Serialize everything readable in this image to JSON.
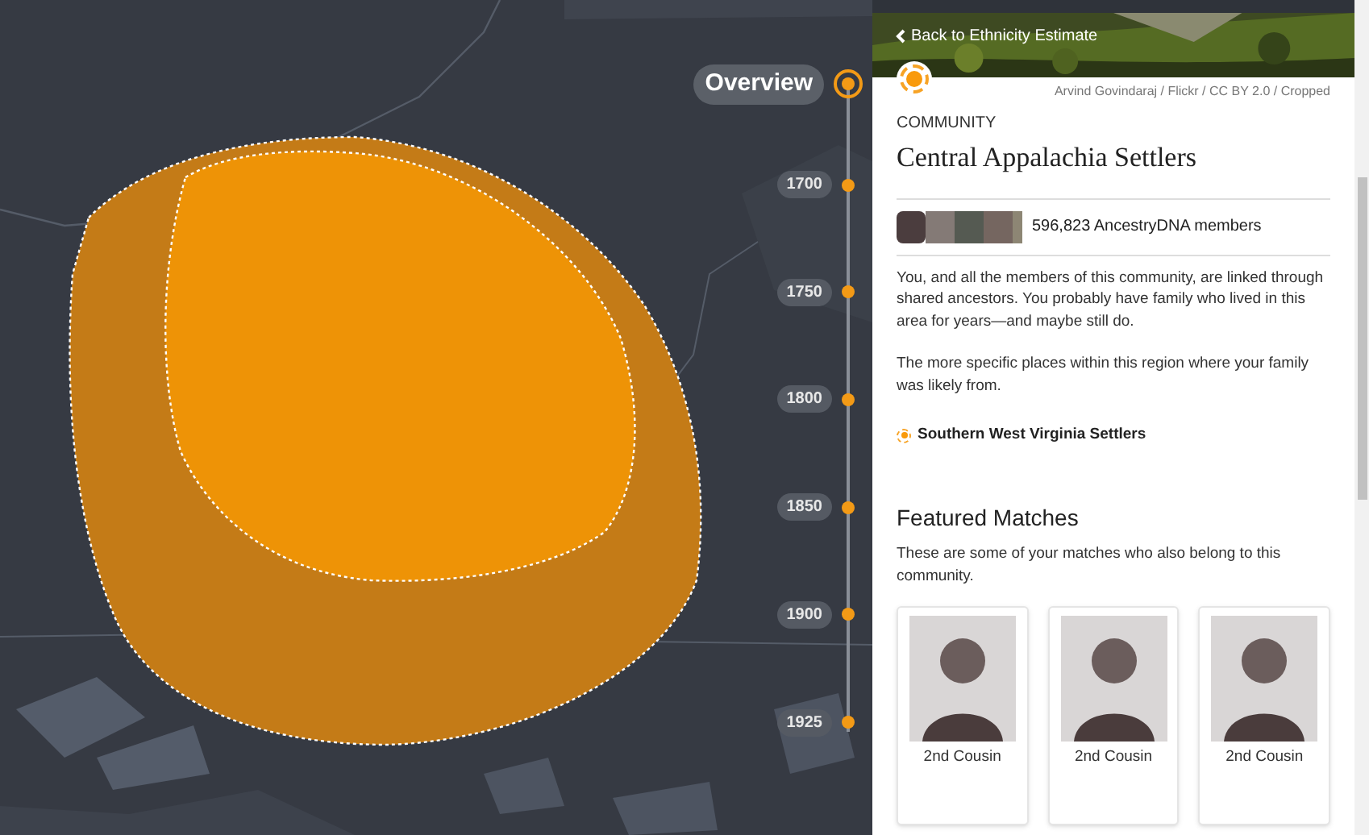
{
  "map": {
    "regions": [
      {
        "color": "#c47b17"
      },
      {
        "color": "#ee9306"
      }
    ]
  },
  "timeline": [
    {
      "label": "Overview",
      "selected": true
    },
    {
      "label": "1700",
      "selected": false
    },
    {
      "label": "1750",
      "selected": false
    },
    {
      "label": "1800",
      "selected": false
    },
    {
      "label": "1850",
      "selected": false
    },
    {
      "label": "1900",
      "selected": false
    },
    {
      "label": "1925",
      "selected": false
    }
  ],
  "panel": {
    "back_link": "Back to Ethnicity Estimate",
    "photo_credit": "Arvind Govindaraj / Flickr / CC BY 2.0 / Cropped",
    "eyebrow": "COMMUNITY",
    "title": "Central Appalachia Settlers",
    "members": "596,823 AncestryDNA members",
    "paragraphs": [
      "You, and all the members of this community, are linked through shared ancestors. You probably have family who lived in this area for years—and maybe still do.",
      "The more specific places within this region where your family was likely from."
    ],
    "sub_communities": [
      {
        "label": "Southern West Virginia Settlers"
      }
    ],
    "featured": {
      "heading": "Featured Matches",
      "description": "These are some of your matches who also belong to this community.",
      "matches": [
        {
          "relationship": "2nd Cousin"
        },
        {
          "relationship": "2nd Cousin"
        },
        {
          "relationship": "2nd Cousin"
        }
      ]
    }
  }
}
